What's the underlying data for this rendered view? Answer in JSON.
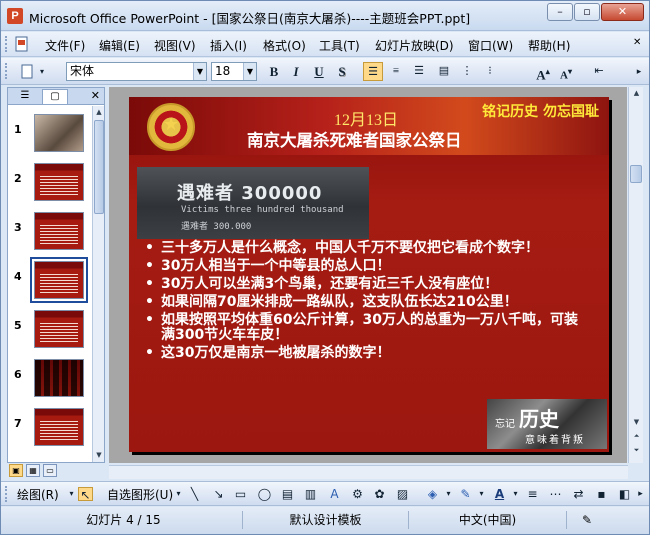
{
  "window": {
    "app_icon": "powerpoint-icon",
    "title": "Microsoft Office PowerPoint - [国家公祭日(南京大屠杀)----主题班会PPT.ppt]",
    "controls": [
      "minimize-icon",
      "restore-icon",
      "close-icon"
    ]
  },
  "menu": {
    "items": [
      "文件(F)",
      "编辑(E)",
      "视图(V)",
      "插入(I)",
      "格式(O)",
      "工具(T)",
      "幻灯片放映(D)",
      "窗口(W)",
      "帮助(H)"
    ]
  },
  "format_toolbar": {
    "font_name": "宋体",
    "font_size": "18",
    "bold": "B",
    "italic": "I",
    "underline": "U",
    "shadow": "S",
    "align_left_active": true,
    "font_grow": "A",
    "font_shrink": "A"
  },
  "slides_pane": {
    "tabs": [
      "outline-tab",
      "slides-tab"
    ],
    "selected_tab": "slides-tab",
    "thumbnails": [
      {
        "num": "1",
        "style": "photo"
      },
      {
        "num": "2",
        "style": "text"
      },
      {
        "num": "3",
        "style": "text"
      },
      {
        "num": "4",
        "style": "text",
        "selected": true
      },
      {
        "num": "5",
        "style": "text"
      },
      {
        "num": "6",
        "style": "collage"
      },
      {
        "num": "7",
        "style": "text"
      }
    ]
  },
  "slide": {
    "date": "12月13日",
    "motto": "铭记历史  勿忘国耻",
    "title": "南京大屠杀死难者国家公祭日",
    "plaque": {
      "big": "遇难者 300000",
      "en": "Victims three hundred thousand",
      "cn": "遇难者   300.000"
    },
    "bullets": [
      "三十多万人是什么概念，中国人千万不要仅把它看成个数字！",
      "30万人相当于一个中等县的总人口！",
      "30万人可以坐满3个鸟巢，还要有近三千人没有座位！",
      "如果间隔70厘米排成一路纵队，这支队伍长达210公里！",
      "如果按照平均体重60公斤计算，30万人的总重为一万八千吨，可装满300节火车车皮！",
      "这30万仅是南京一地被屠杀的数字！"
    ],
    "history_image": {
      "left": "忘记",
      "big": "历史",
      "bottom": "意味着背叛"
    },
    "colors": {
      "background": "#a51c12",
      "title": "#ffffff",
      "motto": "#ffea3a",
      "date": "#ffe76a"
    }
  },
  "draw_toolbar": {
    "draw_label": "绘图(R)",
    "autoshape_label": "自选图形(U)"
  },
  "status": {
    "slide_info": "幻灯片 4 / 15",
    "template": "默认设计模板",
    "language": "中文(中国)"
  }
}
